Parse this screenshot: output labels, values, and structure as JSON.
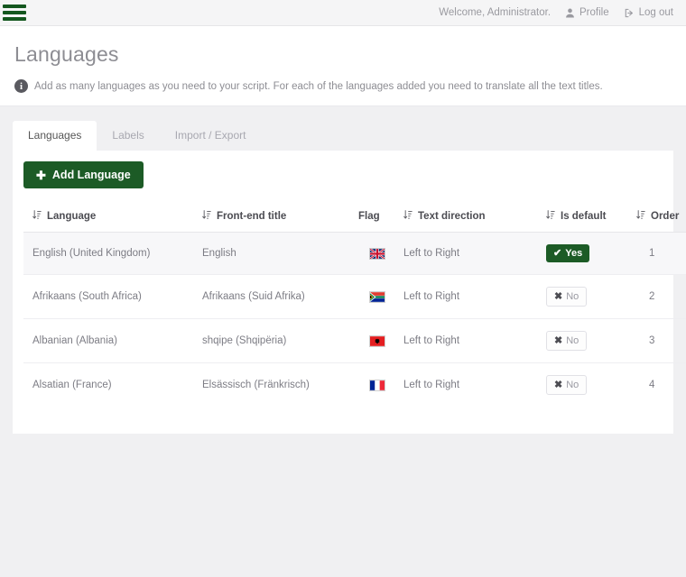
{
  "topbar": {
    "menu_icon": "hamburger-menu-icon",
    "welcome": "Welcome, Administrator.",
    "profile_label": "Profile",
    "profile_icon": "user-icon",
    "logout_label": "Log out",
    "logout_icon": "sign-out-icon"
  },
  "page": {
    "title": "Languages",
    "info_icon": "info-icon",
    "description": "Add as many languages as you need to your script. For each of the languages added you need to translate all the text titles."
  },
  "tabs": [
    {
      "label": "Languages",
      "active": true
    },
    {
      "label": "Labels",
      "active": false
    },
    {
      "label": "Import / Export",
      "active": false
    }
  ],
  "toolbar": {
    "add_label": "Add Language",
    "add_icon": "plus-icon"
  },
  "table": {
    "columns": [
      {
        "label": "Language",
        "sortable": true
      },
      {
        "label": "Front-end title",
        "sortable": true
      },
      {
        "label": "Flag",
        "sortable": false
      },
      {
        "label": "Text direction",
        "sortable": true
      },
      {
        "label": "Is default",
        "sortable": true
      },
      {
        "label": "Order",
        "sortable": true
      }
    ],
    "rows": [
      {
        "language": "English (United Kingdom)",
        "frontend_title": "English",
        "flag": "flag-gb-icon",
        "direction": "Left to Right",
        "is_default": "Yes",
        "is_default_mark": "✔",
        "order": "1",
        "deletable": false
      },
      {
        "language": "Afrikaans (South Africa)",
        "frontend_title": "Afrikaans (Suid Afrika)",
        "flag": "flag-za-icon",
        "direction": "Left to Right",
        "is_default": "No",
        "is_default_mark": "✖",
        "order": "2",
        "deletable": true
      },
      {
        "language": "Albanian (Albania)",
        "frontend_title": "shqipe (Shqipëria)",
        "flag": "flag-al-icon",
        "direction": "Left to Right",
        "is_default": "No",
        "is_default_mark": "✖",
        "order": "3",
        "deletable": true
      },
      {
        "language": "Alsatian (France)",
        "frontend_title": "Elsässisch (Fränkrisch)",
        "flag": "flag-fr-icon",
        "direction": "Left to Right",
        "is_default": "No",
        "is_default_mark": "✖",
        "order": "4",
        "deletable": true
      }
    ],
    "delete_icon": "trash-icon"
  },
  "colors": {
    "brand_green": "#1c5b26",
    "danger_red": "#e8505b",
    "page_bg": "#f0f0f2"
  }
}
